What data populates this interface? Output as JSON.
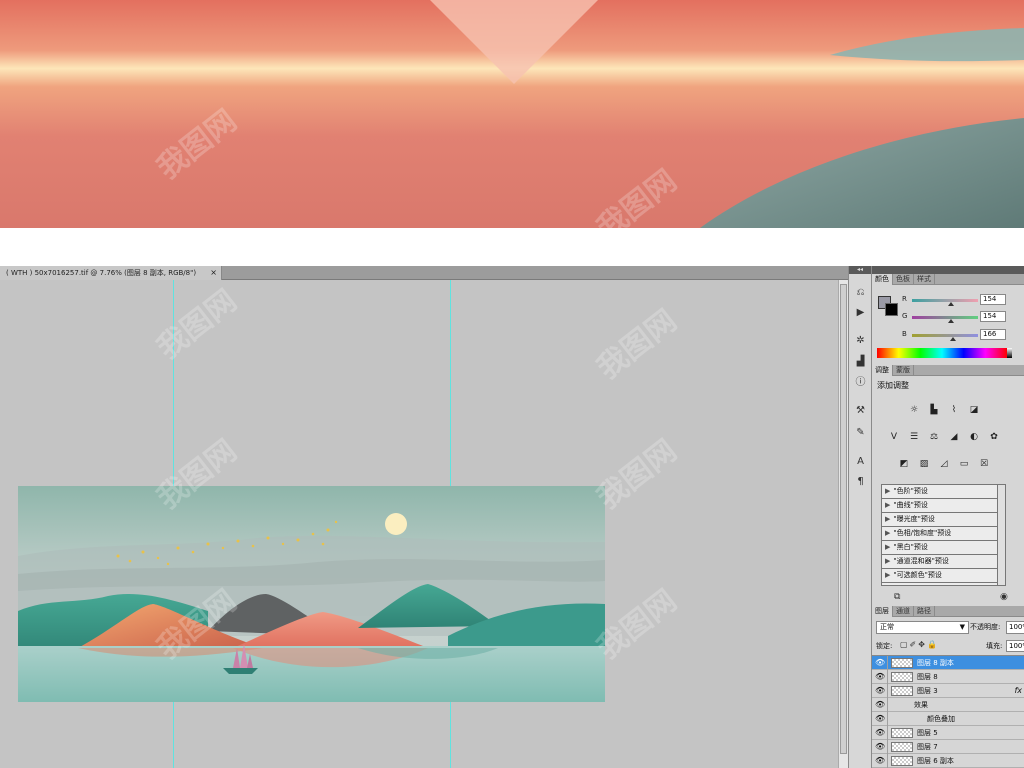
{
  "document": {
    "tab_title": "( WTH ) 50x7016257.tif @ 7.76% (图层 8 副本, RGB/8\")",
    "close_glyph": "×"
  },
  "icon_strip": {
    "collapse_glyph": "◂◂",
    "icons": [
      "history-icon",
      "actions-icon",
      "navigator-icon",
      "histogram-icon",
      "info-icon",
      "tool-presets-icon",
      "brushes-icon",
      "character-icon",
      "paragraph-icon"
    ]
  },
  "panels": {
    "collapse_glyph": "◂◂",
    "color_panel": {
      "tabs": [
        "颜色",
        "色板",
        "样式"
      ],
      "channels": [
        {
          "label": "R",
          "value": "154"
        },
        {
          "label": "G",
          "value": "154"
        },
        {
          "label": "B",
          "value": "166"
        }
      ]
    },
    "adjustments_panel": {
      "tabs": [
        "调整",
        "蒙版"
      ],
      "title": "添加调整",
      "presets": [
        "\"色阶\"预设",
        "\"曲线\"预设",
        "\"曝光度\"预设",
        "\"色相/饱和度\"预设",
        "\"黑白\"预设",
        "\"通道混和器\"预设",
        "\"可选颜色\"预设"
      ]
    },
    "layers_panel": {
      "tabs": [
        "图层",
        "通道",
        "路径"
      ],
      "blend_mode": "正常",
      "opacity_label": "不透明度:",
      "opacity_value": "100%",
      "lock_label": "锁定:",
      "fill_label": "填充:",
      "fill_value": "100%",
      "layers": [
        {
          "name": "图层 8 副本",
          "selected": true
        },
        {
          "name": "图层 8"
        },
        {
          "name": "图层 3",
          "fx": "fx"
        },
        {
          "name": "效果"
        },
        {
          "name": "颜色叠加"
        },
        {
          "name": "图层 5"
        },
        {
          "name": "图层 7"
        },
        {
          "name": "图层 6 副本"
        }
      ]
    }
  },
  "watermark": "我图网",
  "colors": {
    "canvas_bg": "#c4c4c4",
    "guide": "#5fe3e0",
    "selected_layer": "#3d8fe0",
    "coral": "#e0766a",
    "teal": "#3c9a8c"
  }
}
